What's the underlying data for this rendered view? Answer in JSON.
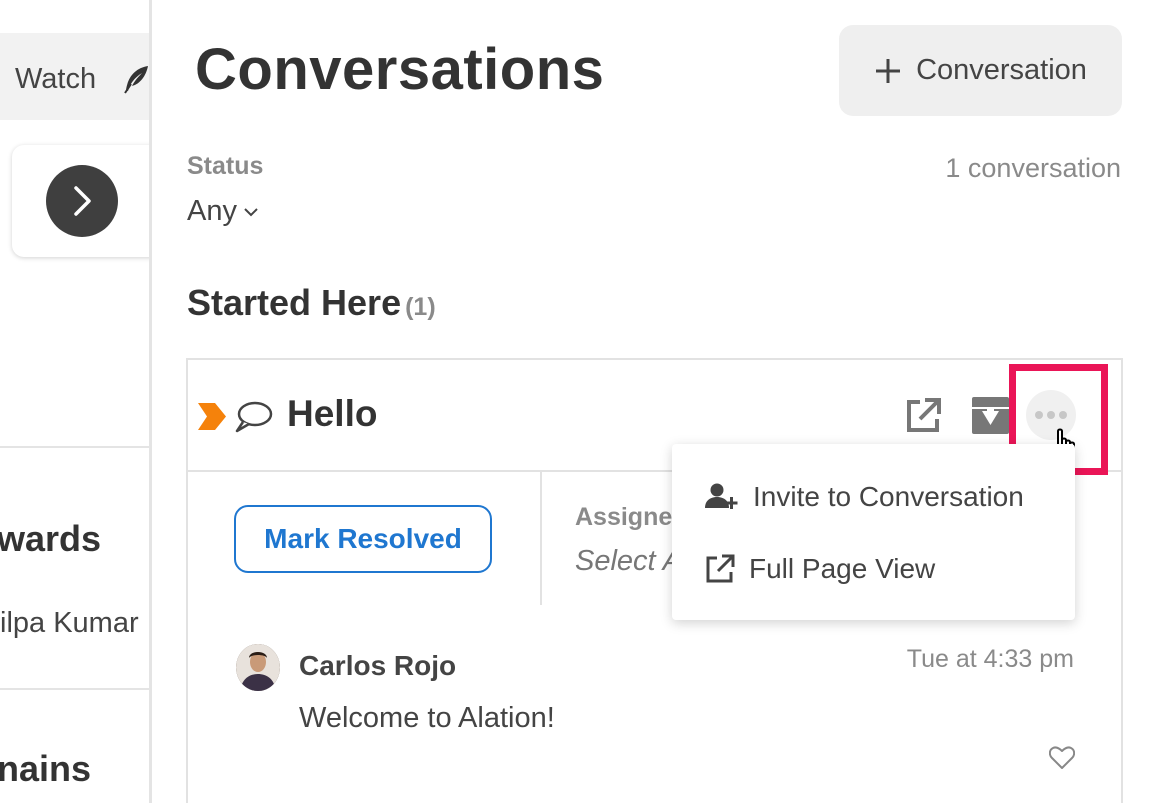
{
  "left_panel": {
    "watch_label": "Watch",
    "heading_1": "wards",
    "person": "ilpa Kumar",
    "heading_2": "nains"
  },
  "header": {
    "title": "Conversations",
    "new_button_label": "Conversation"
  },
  "filters": {
    "status_label": "Status",
    "status_value": "Any",
    "count_text": "1 conversation"
  },
  "section": {
    "title": "Started Here",
    "count": "(1)"
  },
  "conversation": {
    "title": "Hello",
    "resolve_label": "Mark Resolved",
    "assignee_label": "Assignee",
    "assignee_placeholder": "Select Assignee",
    "menu": {
      "invite_label": "Invite to Conversation",
      "full_page_label": "Full Page View"
    },
    "message": {
      "author": "Carlos Rojo",
      "time": "Tue at 4:33 pm",
      "text": "Welcome to Alation!"
    }
  },
  "colors": {
    "accent_blue": "#1f77d0",
    "highlight": "#ea1557",
    "priority_flag": "#f5820b"
  }
}
